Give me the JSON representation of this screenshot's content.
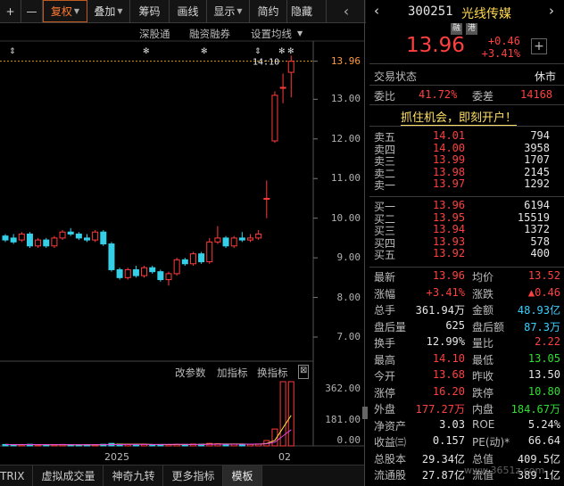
{
  "toolbar": {
    "items": [
      "+",
      "—",
      "复权",
      "叠加",
      "筹码",
      "画线",
      "显示",
      "简约",
      "隐藏"
    ]
  },
  "subtoolbar": {
    "items": [
      "深股通",
      "融资融券",
      "设置均线"
    ]
  },
  "chart_data": {
    "type": "candlestick",
    "price_axis": [
      "13.96",
      "13.00",
      "12.00",
      "11.00",
      "10.00",
      "9.00",
      "8.00",
      "7.00"
    ],
    "price_ylim": [
      7.0,
      14.2
    ],
    "last_price_label": "14:10",
    "volume_axis": [
      "362.00",
      "181.00",
      "0.00"
    ],
    "x_labels": [
      "2025",
      "02"
    ],
    "candles": [
      {
        "o": 9.55,
        "c": 9.45,
        "h": 9.6,
        "l": 9.4
      },
      {
        "o": 9.5,
        "c": 9.4,
        "h": 9.6,
        "l": 9.35
      },
      {
        "o": 9.45,
        "c": 9.6,
        "h": 9.65,
        "l": 9.4
      },
      {
        "o": 9.6,
        "c": 9.3,
        "h": 9.65,
        "l": 9.25
      },
      {
        "o": 9.3,
        "c": 9.45,
        "h": 9.5,
        "l": 9.25
      },
      {
        "o": 9.45,
        "c": 9.3,
        "h": 9.5,
        "l": 9.25
      },
      {
        "o": 9.3,
        "c": 9.5,
        "h": 9.55,
        "l": 9.25
      },
      {
        "o": 9.5,
        "c": 9.65,
        "h": 9.7,
        "l": 9.45
      },
      {
        "o": 9.65,
        "c": 9.6,
        "h": 9.75,
        "l": 9.55
      },
      {
        "o": 9.6,
        "c": 9.5,
        "h": 9.65,
        "l": 9.45
      },
      {
        "o": 9.5,
        "c": 9.45,
        "h": 9.6,
        "l": 9.4
      },
      {
        "o": 9.45,
        "c": 9.65,
        "h": 9.7,
        "l": 9.4
      },
      {
        "o": 9.65,
        "c": 9.35,
        "h": 9.7,
        "l": 9.3
      },
      {
        "o": 9.35,
        "c": 8.7,
        "h": 9.4,
        "l": 8.65
      },
      {
        "o": 8.7,
        "c": 8.5,
        "h": 8.75,
        "l": 8.45
      },
      {
        "o": 8.5,
        "c": 8.7,
        "h": 8.75,
        "l": 8.45
      },
      {
        "o": 8.7,
        "c": 8.55,
        "h": 8.8,
        "l": 8.5
      },
      {
        "o": 8.55,
        "c": 8.75,
        "h": 8.8,
        "l": 8.5
      },
      {
        "o": 8.75,
        "c": 8.65,
        "h": 8.8,
        "l": 8.6
      },
      {
        "o": 8.65,
        "c": 8.45,
        "h": 8.7,
        "l": 8.4
      },
      {
        "o": 8.45,
        "c": 8.6,
        "h": 8.65,
        "l": 8.3
      },
      {
        "o": 8.6,
        "c": 8.95,
        "h": 9.0,
        "l": 8.55
      },
      {
        "o": 8.95,
        "c": 8.85,
        "h": 9.0,
        "l": 8.8
      },
      {
        "o": 8.85,
        "c": 9.1,
        "h": 9.15,
        "l": 8.8
      },
      {
        "o": 9.1,
        "c": 8.9,
        "h": 9.15,
        "l": 8.85
      },
      {
        "o": 8.9,
        "c": 9.4,
        "h": 9.5,
        "l": 8.85
      },
      {
        "o": 9.4,
        "c": 9.5,
        "h": 9.8,
        "l": 9.35
      },
      {
        "o": 9.5,
        "c": 9.3,
        "h": 9.55,
        "l": 9.25
      },
      {
        "o": 9.3,
        "c": 9.5,
        "h": 9.55,
        "l": 9.25
      },
      {
        "o": 9.5,
        "c": 9.45,
        "h": 9.65,
        "l": 9.4
      },
      {
        "o": 9.45,
        "c": 9.5,
        "h": 9.6,
        "l": 9.4
      },
      {
        "o": 9.5,
        "c": 9.6,
        "h": 9.7,
        "l": 9.45
      },
      {
        "o": 10.5,
        "c": 10.5,
        "h": 10.95,
        "l": 10.0
      },
      {
        "o": 11.95,
        "c": 13.1,
        "h": 13.2,
        "l": 11.9
      },
      {
        "o": 13.3,
        "c": 13.3,
        "h": 13.65,
        "l": 12.9
      },
      {
        "o": 13.68,
        "c": 13.96,
        "h": 14.1,
        "l": 13.05
      }
    ],
    "volumes": [
      8,
      6,
      7,
      9,
      6,
      5,
      7,
      8,
      6,
      5,
      6,
      7,
      9,
      14,
      10,
      8,
      7,
      9,
      6,
      8,
      7,
      9,
      8,
      10,
      9,
      14,
      12,
      9,
      10,
      8,
      9,
      11,
      30,
      95,
      362,
      362
    ]
  },
  "panel_toolbar": {
    "items": [
      "改参数",
      "加指标",
      "换指标"
    ],
    "close": "⊠"
  },
  "bottom_tabs": [
    "TRIX",
    "虚拟成交量",
    "神奇九转",
    "更多指标",
    "模板"
  ],
  "quote": {
    "code": "300251",
    "name": "光线传媒",
    "badges": [
      "融",
      "港"
    ],
    "price": "13.96",
    "change": "+0.46",
    "change_pct": "+3.41%",
    "status_label": "交易状态",
    "status_value": "休市",
    "weibi_label": "委比",
    "weibi_value": "41.72%",
    "weicha_label": "委差",
    "weicha_value": "14168",
    "promo": "抓住机会，即刻开户！",
    "asks": [
      {
        "label": "卖五",
        "price": "14.01",
        "vol": "794"
      },
      {
        "label": "卖四",
        "price": "14.00",
        "vol": "3958"
      },
      {
        "label": "卖三",
        "price": "13.99",
        "vol": "1707"
      },
      {
        "label": "卖二",
        "price": "13.98",
        "vol": "2145"
      },
      {
        "label": "卖一",
        "price": "13.97",
        "vol": "1292"
      }
    ],
    "bids": [
      {
        "label": "买一",
        "price": "13.96",
        "vol": "6194"
      },
      {
        "label": "买二",
        "price": "13.95",
        "vol": "15519"
      },
      {
        "label": "买三",
        "price": "13.94",
        "vol": "1372"
      },
      {
        "label": "买四",
        "price": "13.93",
        "vol": "578"
      },
      {
        "label": "买五",
        "price": "13.92",
        "vol": "400"
      }
    ],
    "stats": [
      {
        "l1": "最新",
        "v1": "13.96",
        "c1": "red",
        "l2": "均价",
        "v2": "13.52",
        "c2": "red"
      },
      {
        "l1": "涨幅",
        "v1": "+3.41%",
        "c1": "red",
        "l2": "涨跌",
        "v2": "▲0.46",
        "c2": "red"
      },
      {
        "l1": "总手",
        "v1": "361.94万",
        "c1": "white",
        "l2": "金额",
        "v2": "48.93亿",
        "c2": "cyan"
      },
      {
        "l1": "盘后量",
        "v1": "625",
        "c1": "white",
        "l2": "盘后额",
        "v2": "87.3万",
        "c2": "cyan"
      },
      {
        "l1": "换手",
        "v1": "12.99%",
        "c1": "white",
        "l2": "量比",
        "v2": "2.22",
        "c2": "red"
      },
      {
        "l1": "最高",
        "v1": "14.10",
        "c1": "red",
        "l2": "最低",
        "v2": "13.05",
        "c2": "green"
      },
      {
        "l1": "今开",
        "v1": "13.68",
        "c1": "red",
        "l2": "昨收",
        "v2": "13.50",
        "c2": "white"
      },
      {
        "l1": "涨停",
        "v1": "16.20",
        "c1": "red",
        "l2": "跌停",
        "v2": "10.80",
        "c2": "green"
      },
      {
        "l1": "外盘",
        "v1": "177.27万",
        "c1": "red",
        "l2": "内盘",
        "v2": "184.67万",
        "c2": "green"
      },
      {
        "l1": "净资产",
        "v1": "3.03",
        "c1": "white",
        "l2": "ROE",
        "v2": "5.24%",
        "c2": "white"
      },
      {
        "l1": "收益㈢",
        "v1": "0.157",
        "c1": "white",
        "l2": "PE(动)*",
        "v2": "66.64",
        "c2": "white"
      },
      {
        "l1": "总股本",
        "v1": "29.34亿",
        "c1": "white",
        "l2": "总值",
        "v2": "409.5亿",
        "c2": "white"
      },
      {
        "l1": "流通股",
        "v1": "27.87亿",
        "c1": "white",
        "l2": "流值",
        "v2": "389.1亿",
        "c2": "white"
      }
    ]
  },
  "watermark": "www.3651z.com"
}
